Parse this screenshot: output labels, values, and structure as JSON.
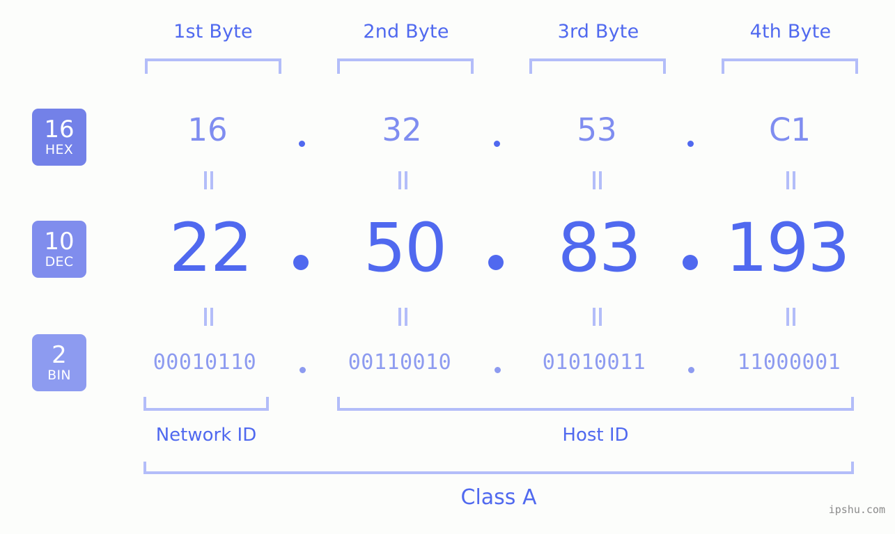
{
  "meta": {
    "background_color": "#fcfdfb",
    "accent_color": "#5069ef",
    "light_accent_color": "#b3bdf9",
    "mid_accent_color": "#8d9bf0"
  },
  "byte_headers": [
    {
      "label": "1st Byte"
    },
    {
      "label": "2nd Byte"
    },
    {
      "label": "3rd Byte"
    },
    {
      "label": "4th Byte"
    }
  ],
  "radix_badges": [
    {
      "base": "16",
      "name": "HEX",
      "color": "#7381e8"
    },
    {
      "base": "10",
      "name": "DEC",
      "color": "#808ded"
    },
    {
      "base": "2",
      "name": "BIN",
      "color": "#8d9bf0"
    }
  ],
  "separator": ".",
  "equals_mark": "=",
  "rows": {
    "hex": {
      "radix_label": "HEX",
      "octets": [
        "16",
        "32",
        "53",
        "C1"
      ]
    },
    "dec": {
      "radix_label": "DEC",
      "octets": [
        "22",
        "50",
        "83",
        "193"
      ]
    },
    "bin": {
      "radix_label": "BIN",
      "octets": [
        "00010110",
        "00110010",
        "01010011",
        "11000001"
      ]
    }
  },
  "address": {
    "hex": "16.32.53.C1",
    "dec": "22.50.83.193",
    "bin": "00010110.00110010.01010011.11000001"
  },
  "partition": {
    "network_id_label": "Network ID",
    "host_id_label": "Host ID",
    "network_id_bytes": 1,
    "host_id_bytes": 3
  },
  "class": {
    "label": "Class A"
  },
  "watermark": {
    "text": "ipshu.com"
  }
}
